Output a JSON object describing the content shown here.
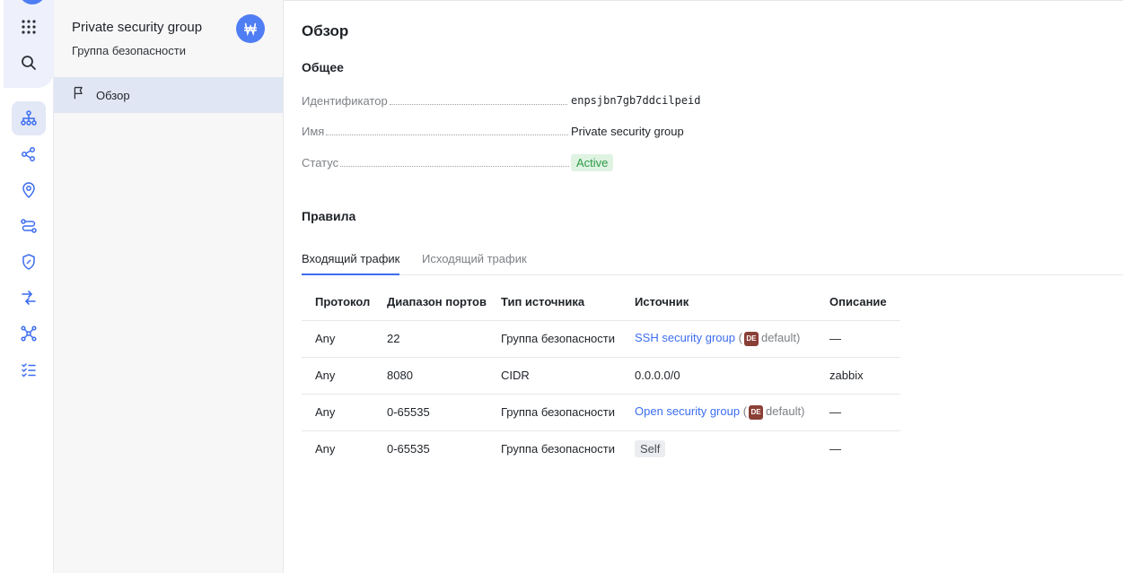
{
  "rail": {
    "icons": [
      "apps-grid-icon",
      "search-icon",
      "network-icon",
      "connections-icon",
      "location-pin-icon",
      "routes-icon",
      "shield-icon",
      "swap-arrows-icon",
      "nodes-icon",
      "checklist-icon"
    ]
  },
  "panel": {
    "title": "Private security group",
    "subtitle": "Группа безопасности",
    "badge_icon": "security-group-icon",
    "nav": [
      {
        "label": "Обзор",
        "icon": "flag-icon"
      }
    ]
  },
  "main": {
    "title": "Обзор",
    "general": {
      "heading": "Общее",
      "fields": [
        {
          "key": "Идентификатор",
          "value": "enpsjbn7gb7ddcilpeid"
        },
        {
          "key": "Имя",
          "value": "Private security group"
        },
        {
          "key": "Статус",
          "value": "Active"
        }
      ]
    },
    "rules": {
      "heading": "Правила",
      "tabs": [
        "Входящий трафик",
        "Исходящий трафик"
      ],
      "columns": [
        "Протокол",
        "Диапазон портов",
        "Тип источника",
        "Источник",
        "Описание"
      ],
      "rows": [
        {
          "protocol": "Any",
          "ports": "22",
          "source_type": "Группа безопасности",
          "source": "SSH security group",
          "folder_badge": "DE",
          "folder": "default",
          "description": "—"
        },
        {
          "protocol": "Any",
          "ports": "8080",
          "source_type": "CIDR",
          "source": "0.0.0.0/0",
          "description": "zabbix"
        },
        {
          "protocol": "Any",
          "ports": "0-65535",
          "source_type": "Группа безопасности",
          "source": "Open security group",
          "folder_badge": "DE",
          "folder": "default",
          "description": "—"
        },
        {
          "protocol": "Any",
          "ports": "0-65535",
          "source_type": "Группа безопасности",
          "source": "Self",
          "description": "—"
        }
      ]
    }
  },
  "colors": {
    "accent": "#3c6df0",
    "status_active_bg": "#dff3e2",
    "status_active_fg": "#2e9b47",
    "folder_badge": "#8a3f36"
  }
}
